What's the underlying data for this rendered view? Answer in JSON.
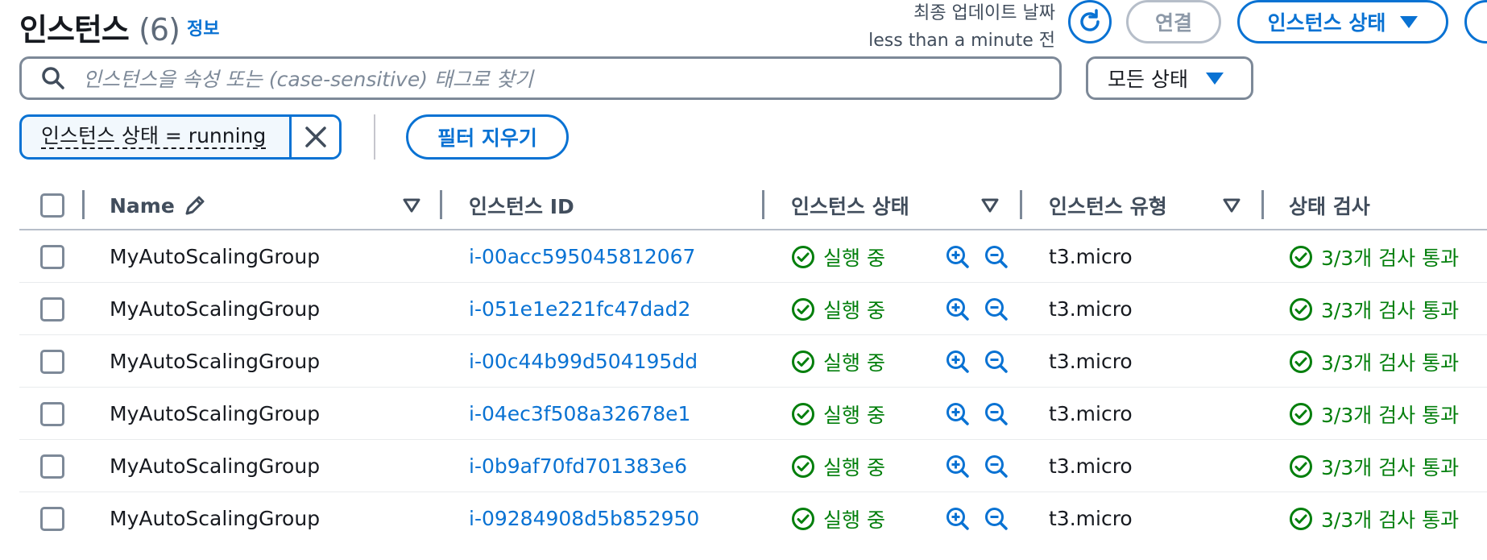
{
  "header": {
    "title": "인스턴스",
    "count": "(6)",
    "info_link": "정보",
    "last_updated_label": "최종 업데이트 날짜",
    "last_updated_value": "less than a minute 전",
    "connect_label": "연결",
    "instance_state_label": "인스턴스 상태"
  },
  "search": {
    "placeholder": "인스턴스을 속성 또는 (case-sensitive) 태그로 찾기",
    "state_filter": "모든 상태"
  },
  "filters": {
    "token": "인스턴스 상태 = running",
    "clear_label": "필터 지우기"
  },
  "table": {
    "columns": {
      "name": "Name",
      "instance_id": "인스턴스 ID",
      "instance_state": "인스턴스 상태",
      "instance_type": "인스턴스 유형",
      "status_check": "상태 검사"
    },
    "rows": [
      {
        "name": "MyAutoScalingGroup",
        "id": "i-00acc595045812067",
        "state": "실행 중",
        "type": "t3.micro",
        "check": "3/3개 검사 통과"
      },
      {
        "name": "MyAutoScalingGroup",
        "id": "i-051e1e221fc47dad2",
        "state": "실행 중",
        "type": "t3.micro",
        "check": "3/3개 검사 통과"
      },
      {
        "name": "MyAutoScalingGroup",
        "id": "i-00c44b99d504195dd",
        "state": "실행 중",
        "type": "t3.micro",
        "check": "3/3개 검사 통과"
      },
      {
        "name": "MyAutoScalingGroup",
        "id": "i-04ec3f508a32678e1",
        "state": "실행 중",
        "type": "t3.micro",
        "check": "3/3개 검사 통과"
      },
      {
        "name": "MyAutoScalingGroup",
        "id": "i-0b9af70fd701383e6",
        "state": "실행 중",
        "type": "t3.micro",
        "check": "3/3개 검사 통과"
      },
      {
        "name": "MyAutoScalingGroup",
        "id": "i-09284908d5b852950",
        "state": "실행 중",
        "type": "t3.micro",
        "check": "3/3개 검사 통과"
      }
    ]
  },
  "colors": {
    "accent": "#0972d3",
    "success": "#037f0c",
    "border": "#7d8998"
  }
}
